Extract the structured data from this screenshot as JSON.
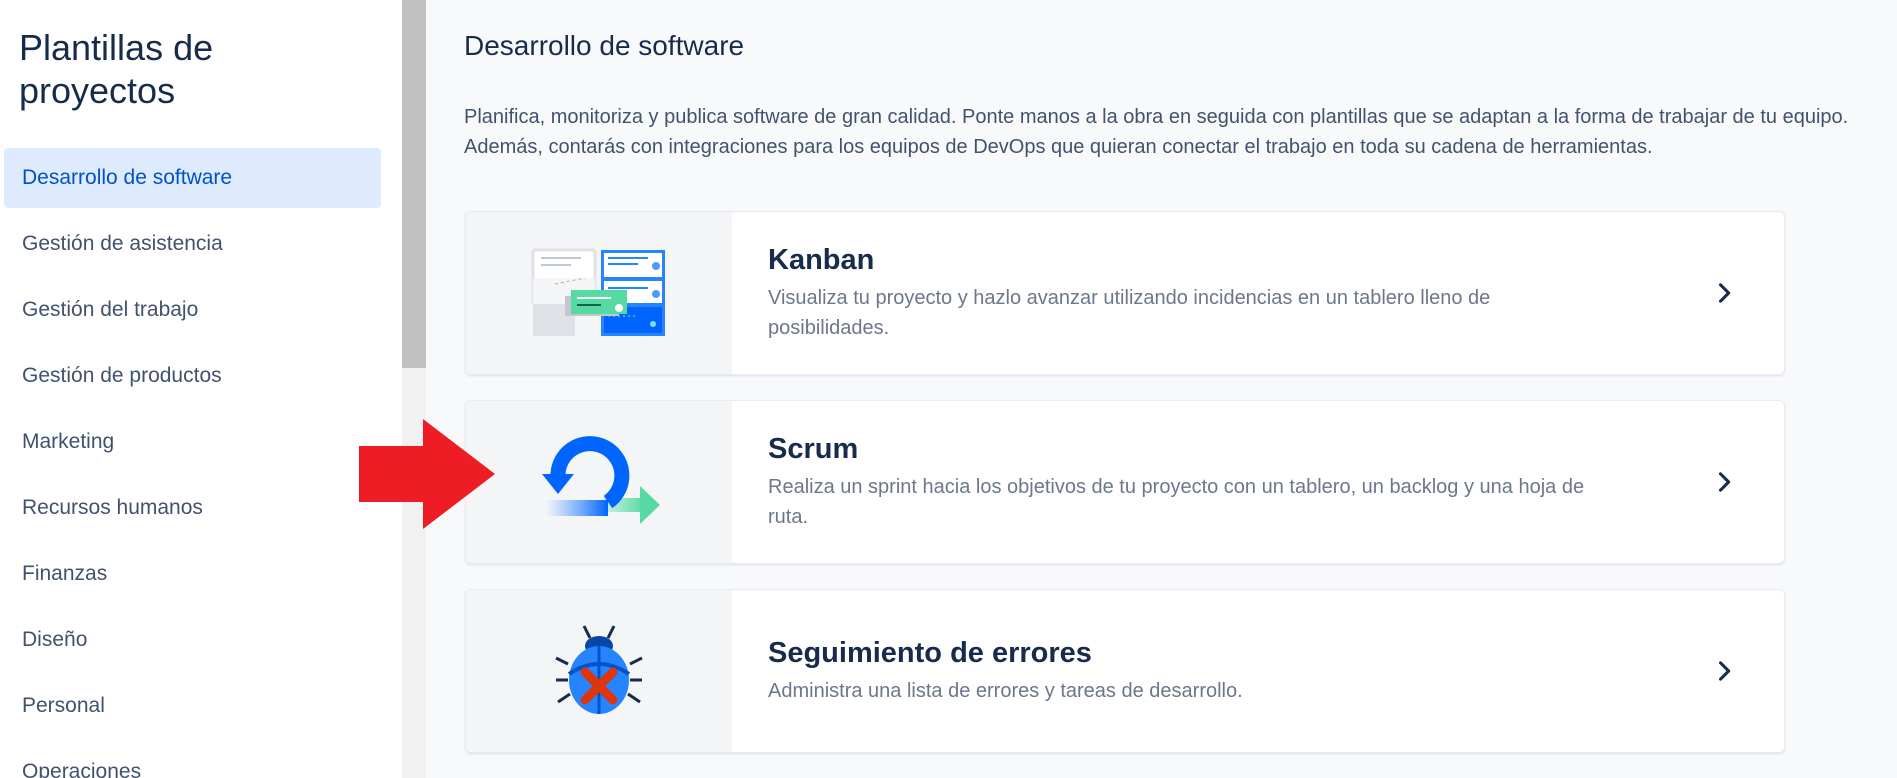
{
  "sidebar": {
    "title": "Plantillas de proyectos",
    "items": [
      {
        "label": "Desarrollo de software",
        "active": true
      },
      {
        "label": "Gestión de asistencia"
      },
      {
        "label": "Gestión del trabajo"
      },
      {
        "label": "Gestión de productos"
      },
      {
        "label": "Marketing"
      },
      {
        "label": "Recursos humanos"
      },
      {
        "label": "Finanzas"
      },
      {
        "label": "Diseño"
      },
      {
        "label": "Personal"
      },
      {
        "label": "Operaciones"
      }
    ]
  },
  "main": {
    "title": "Desarrollo de software",
    "description": "Planifica, monitoriza y publica software de gran calidad. Ponte manos a la obra en seguida con plantillas que se adaptan a la forma de trabajar de tu equipo. Además, contarás con integraciones para los equipos de DevOps que quieran conectar el trabajo en toda su cadena de herramientas.",
    "cards": [
      {
        "title": "Kanban",
        "description": "Visualiza tu proyecto y hazlo avanzar utilizando incidencias en un tablero lleno de posibilidades.",
        "icon": "kanban-board-icon"
      },
      {
        "title": "Scrum",
        "description": "Realiza un sprint hacia los objetivos de tu proyecto con un tablero, un backlog y una hoja de ruta.",
        "icon": "scrum-cycle-icon"
      },
      {
        "title": "Seguimiento de errores",
        "description": "Administra una lista de errores y tareas de desarrollo.",
        "icon": "bug-tracking-icon"
      }
    ]
  },
  "colors": {
    "accent": "#0052cc",
    "active_bg": "#deebff",
    "annotation_arrow": "#ee1c25"
  }
}
